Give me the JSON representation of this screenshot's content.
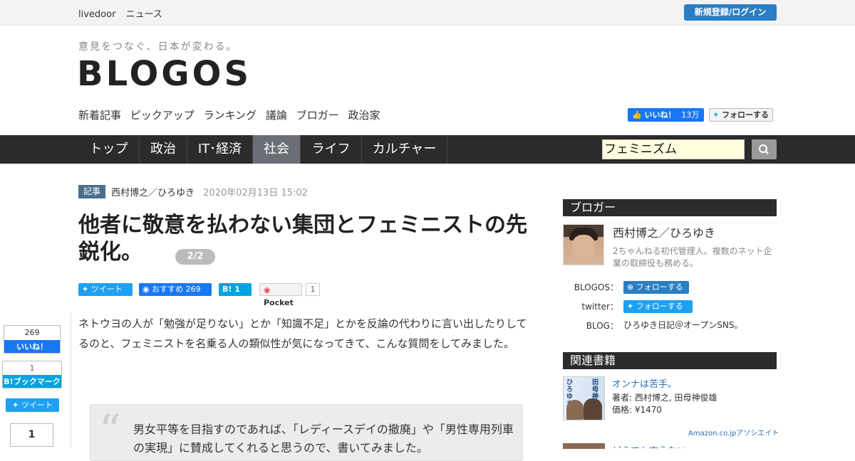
{
  "topbar": {
    "brand_1": "livedoor",
    "brand_2": "ニュース",
    "login": "新規登録/ログイン"
  },
  "header": {
    "tagline": "意見をつなぐ、日本が変わる。",
    "logo": "BLOGOS",
    "subnav": [
      "新着記事",
      "ピックアップ",
      "ランキング",
      "議論",
      "ブロガー",
      "政治家"
    ],
    "fb_like_label": "いいね！",
    "fb_like_count": "13万",
    "tw_follow": "フォローする"
  },
  "nav": {
    "tabs": [
      "トップ",
      "政治",
      "IT･経済",
      "社会",
      "ライフ",
      "カルチャー"
    ],
    "active": "社会",
    "search_value": "フェミニズム"
  },
  "article": {
    "badge": "記事",
    "author": "西村博之／ひろゆき",
    "date": "2020年02月13日 15:02",
    "title": "他者に敬意を払わない集団とフェミニストの先鋭化。",
    "page": "2/2",
    "share_tweet": "ツイート",
    "share_fb": "おすすめ",
    "share_fb_count": "269",
    "share_hb": "B!",
    "share_hb_count": "1",
    "share_pocket": "Pocket",
    "share_pocket_count": "1",
    "body": "ネトウヨの人が「勉強が足りない」とか「知識不足」とかを反論の代わりに言い出したりしてるのと、フェミニストを名乗る人の類似性が気になってきて、こんな質問をしてみました。",
    "quote": "男女平等を目指すのであれば、「レディースデイの撤廃」や「男性専用列車の実現」に賛成してくれると思うので、書いてみました。"
  },
  "side_share": {
    "like_count": "269",
    "like_label": "いいね！",
    "hb_count": "1",
    "hb_label": "B!ブックマーク",
    "tweet_label": "ツイート",
    "pocket_count": "1"
  },
  "sidebar": {
    "blogger_head": "ブロガー",
    "blogger_name": "西村博之／ひろゆき",
    "blogger_desc": "2ちゃんねる初代管理人。複数のネット企業の取締役も務める。",
    "blogos_label": "BLOGOS：",
    "blogos_follow": "フォローする",
    "twitter_label": "twitter：",
    "twitter_follow": "フォローする",
    "blog_label": "BLOG：",
    "blog_value": "ひろゆき日記＠オープンSNS。",
    "books_head": "関連書籍",
    "book_title": "オンナは苦手。",
    "book_authors": "著者: 西村博之, 田母神俊雄",
    "book_price": "価格: ¥1470",
    "book_cover_1": "ひろゆき",
    "book_cover_2": "田母神",
    "amazon": "Amazon.co.jpアソシエイト",
    "book2_title": "どうでも言えない"
  },
  "colors": {
    "nav_bg": "#2b2b2b",
    "nav_active": "#6b6f75",
    "brand_blue": "#2a7ec4",
    "twitter": "#1da1f2",
    "facebook": "#1877f2",
    "hatena": "#00a4de"
  }
}
